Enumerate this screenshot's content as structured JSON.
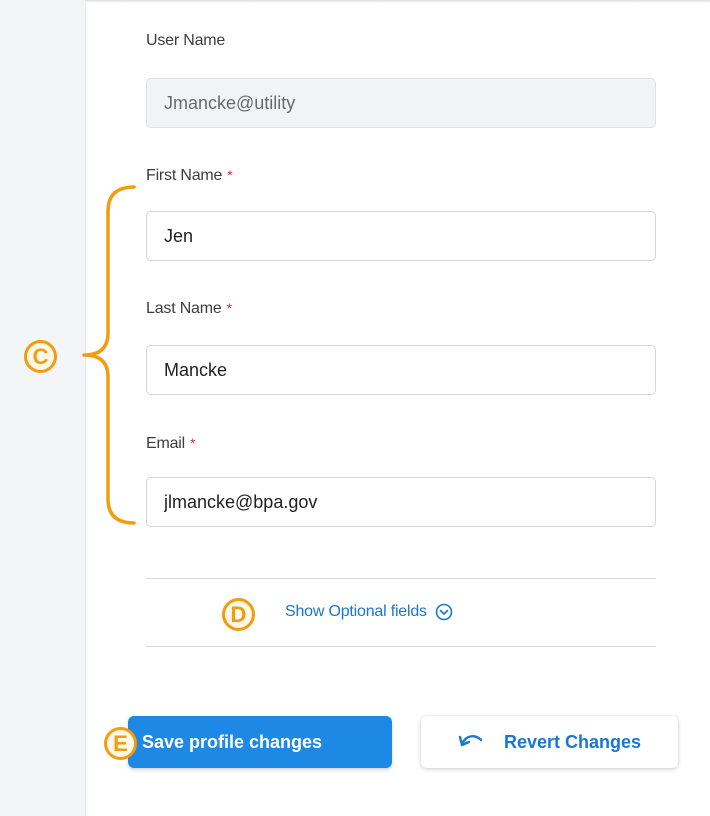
{
  "form": {
    "username": {
      "label": "User Name",
      "value": "Jmancke@utility"
    },
    "first_name": {
      "label": "First Name",
      "required_mark": "*",
      "value": "Jen"
    },
    "last_name": {
      "label": "Last Name",
      "required_mark": "*",
      "value": "Mancke"
    },
    "email": {
      "label": "Email",
      "required_mark": "*",
      "value": "jlmancke@bpa.gov"
    },
    "optional_toggle": {
      "label": "Show Optional fields",
      "icon": "chevron-down-circle-icon"
    }
  },
  "actions": {
    "save_label": "Save profile changes",
    "revert_label": "Revert Changes",
    "revert_icon": "undo-icon"
  },
  "annotations": {
    "c": "C",
    "d": "D",
    "e": "E"
  },
  "colors": {
    "accent": "#1e88e5",
    "link": "#1976d2",
    "required": "#d0312d",
    "annotation": "#f39c12"
  }
}
